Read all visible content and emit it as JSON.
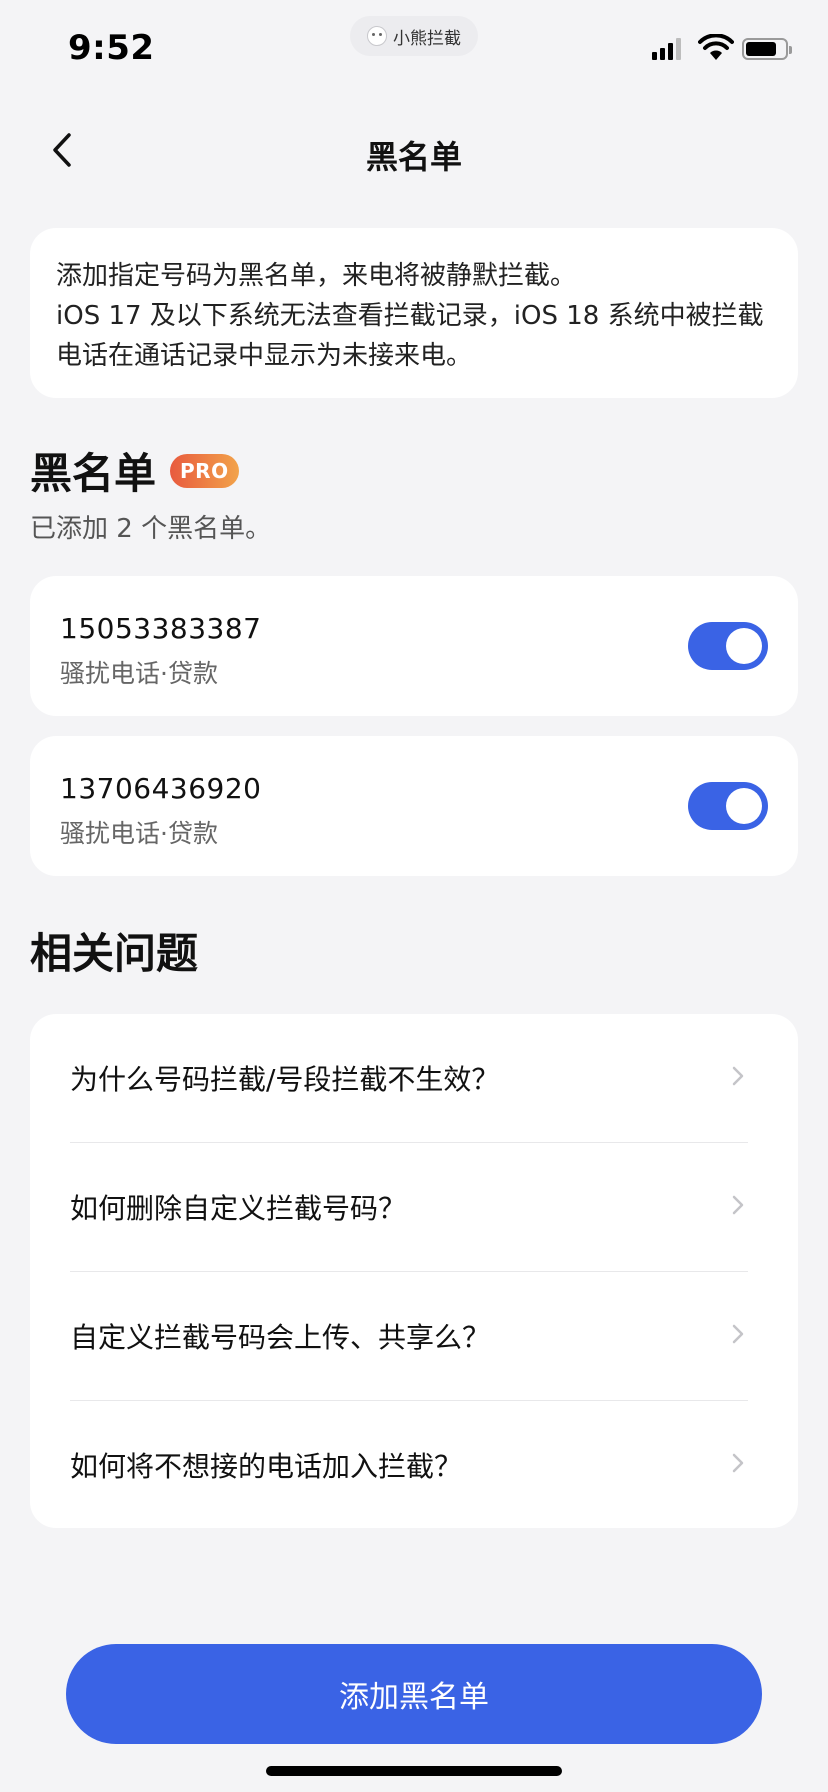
{
  "status_bar": {
    "time": "9:52",
    "app_name": "小熊拦截"
  },
  "nav": {
    "title": "黑名单"
  },
  "info": {
    "line1": "添加指定号码为黑名单，来电将被静默拦截。",
    "line2": "iOS 17 及以下系统无法查看拦截记录，iOS 18 系统中被拦截电话在通话记录中显示为未接来电。"
  },
  "blacklist": {
    "heading": "黑名单",
    "badge": "PRO",
    "count_text": "已添加 2 个黑名单。",
    "items": [
      {
        "number": "15053383387",
        "tag": "骚扰电话·贷款",
        "enabled": true
      },
      {
        "number": "13706436920",
        "tag": "骚扰电话·贷款",
        "enabled": true
      }
    ]
  },
  "faq": {
    "heading": "相关问题",
    "items": [
      {
        "question": "为什么号码拦截/号段拦截不生效？"
      },
      {
        "question": "如何删除自定义拦截号码？"
      },
      {
        "question": "自定义拦截号码会上传、共享么？"
      },
      {
        "question": "如何将不想接的电话加入拦截？"
      }
    ]
  },
  "actions": {
    "add_label": "添加黑名单"
  },
  "colors": {
    "accent": "#3a63e5",
    "background": "#f4f4f6",
    "badge_start": "#e85a3e",
    "badge_end": "#f2a34a"
  }
}
